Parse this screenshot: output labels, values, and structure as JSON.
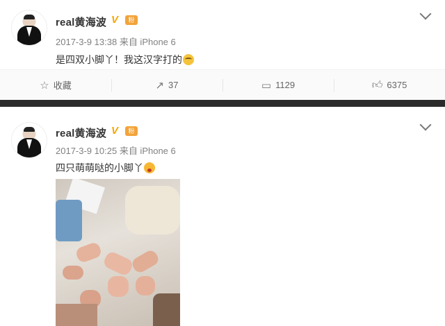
{
  "posts": [
    {
      "author": "real黄海波",
      "medal_label": "粉",
      "timestamp": "2017-3-9 13:38",
      "source": "来自 iPhone 6",
      "text": "是四双小脚丫！我这汉字打的",
      "emoji": "crying-laugh-emoji",
      "actions": {
        "favorite_label": "收藏",
        "repost_count": "37",
        "comment_count": "1129",
        "like_count": "6375"
      }
    },
    {
      "author": "real黄海波",
      "medal_label": "粉",
      "timestamp": "2017-3-9 10:25",
      "source": "来自 iPhone 6",
      "text": "四只萌萌哒的小脚丫",
      "emoji": "shocked-face-emoji"
    }
  ],
  "colors": {
    "verified_badge": "#f7a700",
    "text": "#333333",
    "meta": "#808080",
    "background": "#2b2b2b"
  }
}
